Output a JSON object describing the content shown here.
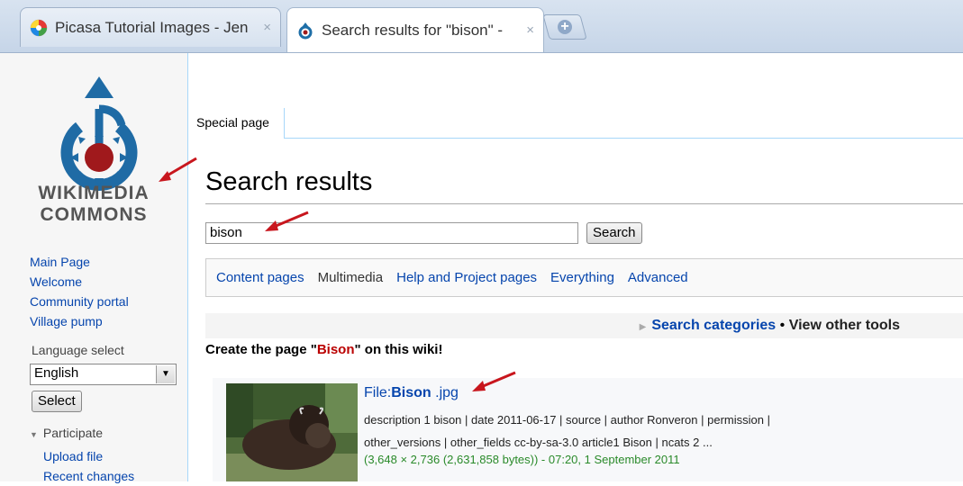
{
  "browser": {
    "tabs": [
      {
        "title": "Picasa Tutorial Images - Jen",
        "active": false
      },
      {
        "title": "Search results for \"bison\" - ",
        "active": true
      }
    ],
    "close_glyph": "×"
  },
  "logo": {
    "line1": "WIKIMEDIA",
    "line2": "COMMONS"
  },
  "sidebar": {
    "nav": [
      "Main Page",
      "Welcome",
      "Community portal",
      "Village pump"
    ],
    "language_label": "Language select",
    "language_value": "English",
    "select_button": "Select",
    "participate_label": "Participate",
    "participate_links": [
      "Upload file",
      "Recent changes"
    ]
  },
  "page": {
    "special_tab": "Special page",
    "title": "Search results",
    "search_value": "bison",
    "search_button": "Search",
    "profiles": [
      {
        "label": "Content pages",
        "selected": false
      },
      {
        "label": "Multimedia",
        "selected": true
      },
      {
        "label": "Help and Project pages",
        "selected": false
      },
      {
        "label": "Everything",
        "selected": false
      },
      {
        "label": "Advanced",
        "selected": false
      }
    ],
    "search_categories": "Search categories",
    "separator": "•",
    "view_other_tools": "View other tools",
    "create_prefix": "Create the page \"",
    "create_term": "Bison",
    "create_suffix": "\" on this wiki!"
  },
  "result": {
    "title_prefix": "File:",
    "title_bold": "Bison",
    "title_suffix": " .jpg",
    "desc_line1": "description 1 bison | date 2011-06-17 | source | author Ronveron | permission |",
    "desc_line2": "other_versions | other_fields cc-by-sa-3.0 article1 Bison | ncats 2 ...",
    "meta": "(3,648 × 2,736 (2,631,858 bytes)) - 07:20, 1 September 2011"
  },
  "colors": {
    "link": "#0645ad",
    "annotation_arrow": "#c8161d",
    "meta_green": "#2a8a2a",
    "create_red": "#ba0000"
  }
}
